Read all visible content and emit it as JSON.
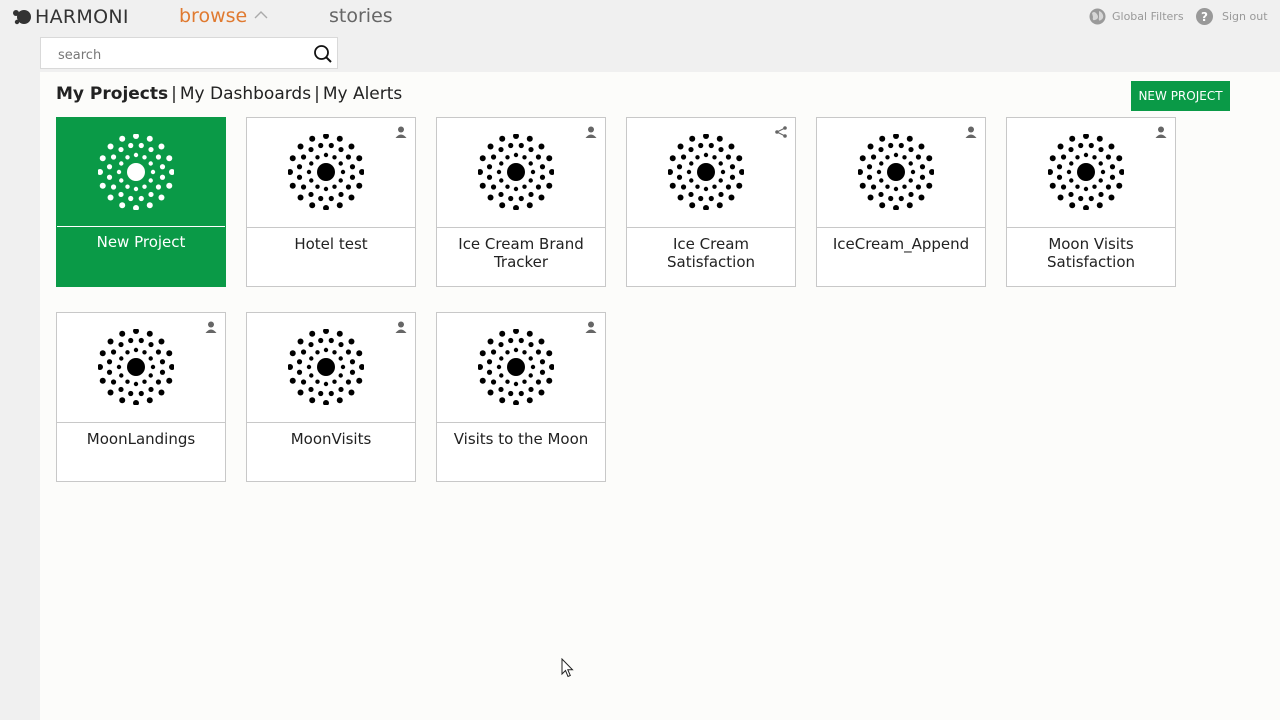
{
  "app": {
    "name": "HARMONI"
  },
  "nav": {
    "browse": "browse",
    "stories": "stories",
    "global_filters": "Global Filters",
    "sign_out": "Sign out"
  },
  "search": {
    "placeholder": "search"
  },
  "tabs": {
    "my_projects": "My Projects",
    "my_dashboards": "My Dashboards",
    "my_alerts": "My Alerts",
    "separator": "|"
  },
  "toolbar": {
    "new_project_label": "NEW PROJECT"
  },
  "colors": {
    "brand_green": "#0a9a47",
    "browse_orange": "#e07a30"
  },
  "new_tile": {
    "label": "New Project"
  },
  "projects": [
    {
      "name": "Hotel test",
      "owner_icon": "user-icon"
    },
    {
      "name": "Ice Cream Brand Tracker",
      "owner_icon": "user-icon"
    },
    {
      "name": "Ice Cream Satisfaction",
      "owner_icon": "share-icon"
    },
    {
      "name": "IceCream_Append",
      "owner_icon": "user-icon"
    },
    {
      "name": "Moon Visits Satisfaction",
      "owner_icon": "user-icon"
    },
    {
      "name": "MoonLandings",
      "owner_icon": "user-icon"
    },
    {
      "name": "MoonVisits",
      "owner_icon": "user-icon"
    },
    {
      "name": "Visits to the Moon",
      "owner_icon": "user-icon"
    }
  ]
}
